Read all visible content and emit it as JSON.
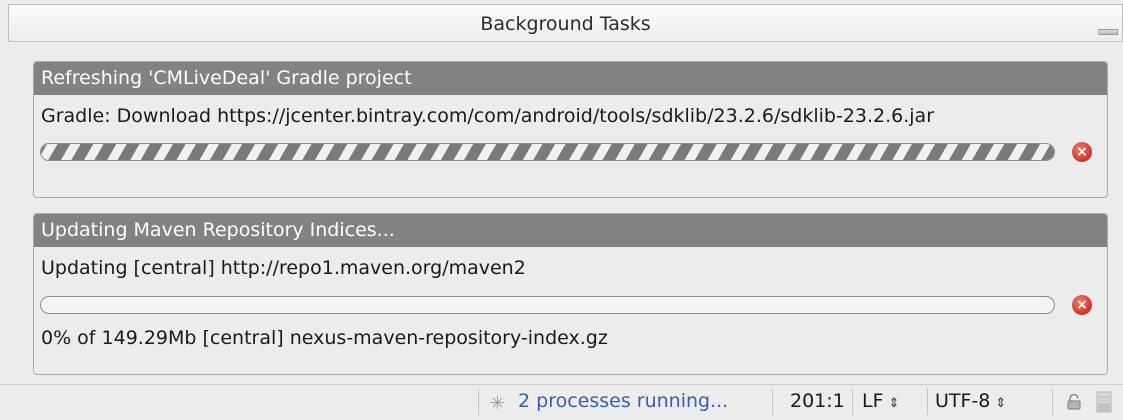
{
  "window": {
    "title": "Background Tasks"
  },
  "tasks": [
    {
      "header": "Refreshing 'CMLiveDeal' Gradle project",
      "detail": "Gradle: Download https://jcenter.bintray.com/com/android/tools/sdklib/23.2.6/sdklib-23.2.6.jar",
      "progress": "indeterminate",
      "footer": ""
    },
    {
      "header": "Updating Maven Repository Indices...",
      "detail": "Updating [central] http://repo1.maven.org/maven2",
      "progress": 0,
      "footer": "0% of 149.29Mb [central] nexus-maven-repository-index.gz"
    }
  ],
  "status_bar": {
    "processes": "2 processes running...",
    "position": "201:1",
    "line_separator": "LF",
    "encoding": "UTF-8"
  },
  "colors": {
    "task_header_bg": "#828282",
    "cancel_icon": "#d2402f",
    "processes_link": "#3a5fa8"
  },
  "icons": {
    "minimize": "minimize-icon",
    "cancel": "cancel-icon",
    "spinner": "spinner-icon",
    "lock": "lock-icon",
    "memory": "memory-indicator-icon"
  }
}
